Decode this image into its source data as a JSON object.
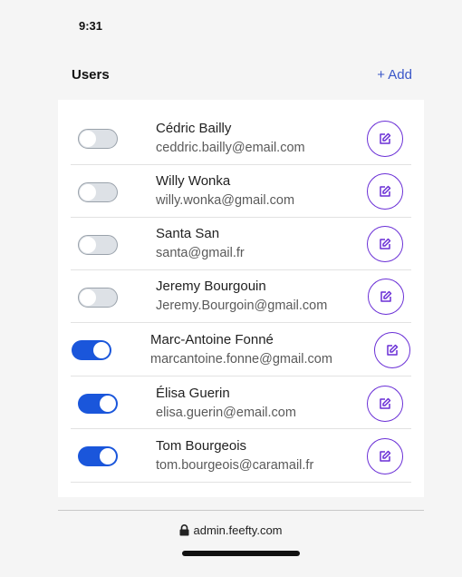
{
  "status_bar": {
    "time": "9:31"
  },
  "header": {
    "title": "Users",
    "add_label": "+ Add"
  },
  "users": [
    {
      "name": "Cédric Bailly",
      "email": "ceddric.bailly@email.com",
      "enabled": false
    },
    {
      "name": "Willy Wonka",
      "email": "willy.wonka@gmail.com",
      "enabled": false
    },
    {
      "name": "Santa San",
      "email": "santa@gmail.fr",
      "enabled": false
    },
    {
      "name": "Jeremy Bourgouin",
      "email": "Jeremy.Bourgoin@gmail.com",
      "enabled": false
    },
    {
      "name": "Marc-Antoine Fonné",
      "email": "marcantoine.fonne@gmail.com",
      "enabled": true
    },
    {
      "name": "Élisa Guerin",
      "email": "elisa.guerin@email.com",
      "enabled": true
    },
    {
      "name": "Tom Bourgeois",
      "email": "tom.bourgeois@caramail.fr",
      "enabled": true
    }
  ],
  "browser": {
    "url": "admin.feefty.com",
    "lock_icon": "lock-icon"
  },
  "colors": {
    "accent_blue": "#1a56db",
    "edit_purple": "#6a2fd6",
    "link_blue": "#3a57c8",
    "toggle_off": "#dde1e6"
  }
}
